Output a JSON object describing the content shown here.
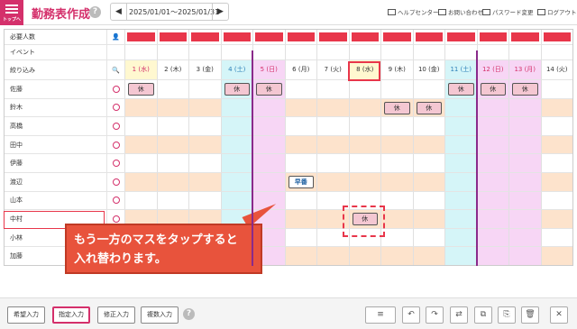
{
  "topbar": {
    "home_label": "トップへ",
    "title": "勤務表作成",
    "help": "?",
    "prev": "◀",
    "next": "▶",
    "date_range": "2025/01/01～2025/01/31",
    "links": [
      "ヘルプセンター",
      "お問い合わせ",
      "パスワード変更",
      "ログアウト"
    ]
  },
  "grid": {
    "required_label": "必要人数",
    "event_label": "イベント",
    "filter_label": "絞り込み",
    "days": [
      "1 (水)",
      "2 (木)",
      "3 (金)",
      "4 (土)",
      "5 (日)",
      "6 (月)",
      "7 (火)",
      "8 (水)",
      "9 (木)",
      "10 (金)",
      "11 (土)",
      "12 (日)",
      "13 (月)",
      "14 (火)"
    ],
    "day_colors": [
      "#fff8d0",
      "#ffffff",
      "#ffffff",
      "#d5f5f8",
      "#f7d6f5",
      "#ffffff",
      "#ffffff",
      "#fff8d0",
      "#ffffff",
      "#ffffff",
      "#d5f5f8",
      "#f7d6f5",
      "#f7d6f5",
      "#ffffff"
    ],
    "staff": [
      {
        "name": "佐藤",
        "shifts": {
          "0": "休",
          "3": "休",
          "4": "休",
          "10": "休",
          "11": "休",
          "12": "休"
        }
      },
      {
        "name": "鈴木",
        "shifts": {
          "8": "休",
          "9": "休"
        }
      },
      {
        "name": "高橋",
        "shifts": {}
      },
      {
        "name": "田中",
        "shifts": {}
      },
      {
        "name": "伊藤",
        "shifts": {}
      },
      {
        "name": "渡辺",
        "shifts": {
          "5": "早番"
        }
      },
      {
        "name": "山本",
        "shifts": {}
      },
      {
        "name": "中村",
        "shifts": {
          "7": "休"
        }
      },
      {
        "name": "小林",
        "shifts": {}
      },
      {
        "name": "加藤",
        "shifts": {}
      }
    ]
  },
  "callout": {
    "line1": "もう一方のマスをタップすると",
    "line2": "入れ替わります。"
  },
  "bottombar": {
    "buttons": [
      "希望入力",
      "指定入力",
      "修正入力",
      "複数入力"
    ],
    "help": "?",
    "tools": [
      "≡",
      "↶",
      "↷",
      "⇄",
      "⧉",
      "⎘",
      "🗑",
      "✕"
    ]
  },
  "colors": {
    "accent": "#d4306b",
    "required_bar": "#e8364a",
    "callout": "#e8533c"
  }
}
